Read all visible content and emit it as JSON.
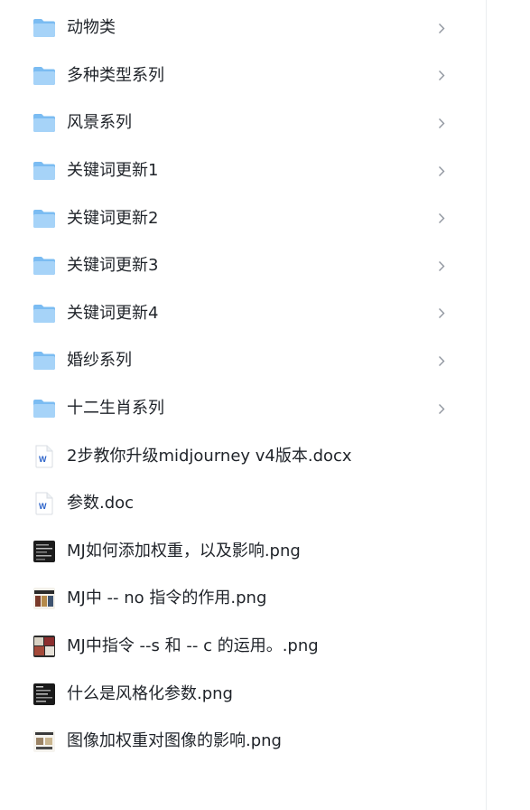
{
  "items": [
    {
      "type": "folder",
      "name": "动物类"
    },
    {
      "type": "folder",
      "name": "多种类型系列"
    },
    {
      "type": "folder",
      "name": "风景系列"
    },
    {
      "type": "folder",
      "name": "关键词更新1"
    },
    {
      "type": "folder",
      "name": "关键词更新2"
    },
    {
      "type": "folder",
      "name": "关键词更新3"
    },
    {
      "type": "folder",
      "name": "关键词更新4"
    },
    {
      "type": "folder",
      "name": "婚纱系列"
    },
    {
      "type": "folder",
      "name": "十二生肖系列"
    },
    {
      "type": "word",
      "name": "2步教你升级midjourney v4版本.docx"
    },
    {
      "type": "word",
      "name": "参数.doc"
    },
    {
      "type": "image",
      "name": "MJ如何添加权重，以及影响.png"
    },
    {
      "type": "image",
      "name": "MJ中 -- no 指令的作用.png"
    },
    {
      "type": "image",
      "name": "MJ中指令 --s 和 -- c 的运用。.png"
    },
    {
      "type": "image",
      "name": "什么是风格化参数.png"
    },
    {
      "type": "image",
      "name": "图像加权重对图像的影响.png"
    }
  ],
  "colors": {
    "folder": "#7bbcf2",
    "folder_light": "#a6d3f8",
    "word": "#2b62c9",
    "chevron": "#8f959e"
  }
}
